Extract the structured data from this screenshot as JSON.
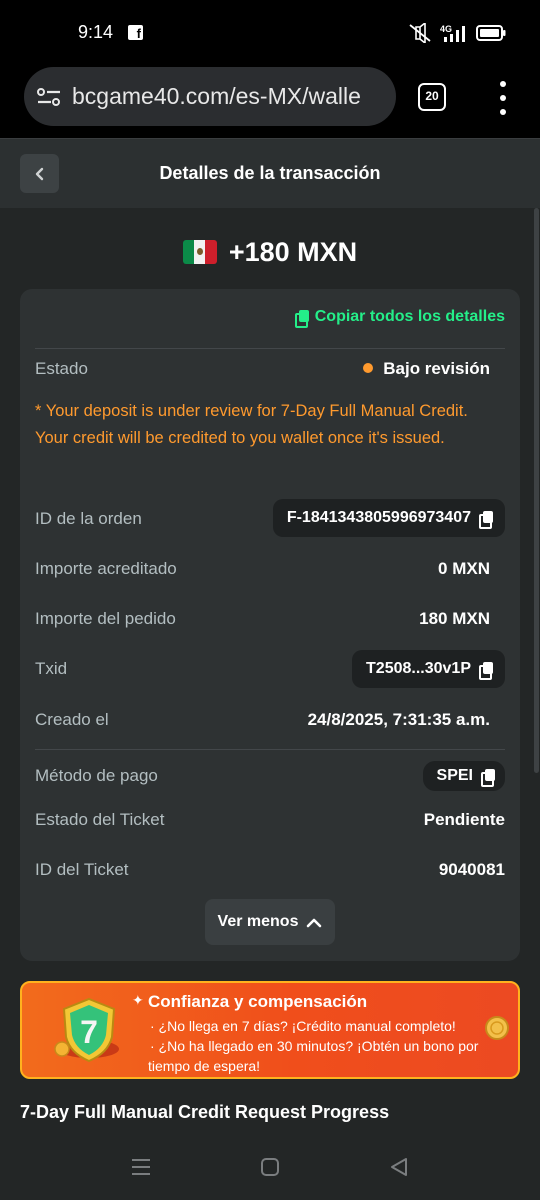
{
  "status_bar": {
    "time": "9:14",
    "network": "4G"
  },
  "browser": {
    "url": "bcgame40.com/es-MX/walle",
    "tab_count": "20"
  },
  "header": {
    "title": "Detalles de la transacción"
  },
  "amount": {
    "text": "+180 MXN",
    "flag": "mexico-flag"
  },
  "details": {
    "copy_all": "Copiar todos los detalles",
    "status_label": "Estado",
    "status_value": "Bajo revisión",
    "notice": "* Your deposit is under review for 7-Day Full Manual Credit. Your credit will be credited to you wallet once it's issued.",
    "order_id_label": "ID de la orden",
    "order_id_value": "F-1841343805996973407",
    "credited_label": "Importe acreditado",
    "credited_value": "0 MXN",
    "order_amount_label": "Importe del pedido",
    "order_amount_value": "180 MXN",
    "txid_label": "Txid",
    "txid_value": "T2508...30v1P",
    "created_label": "Creado el",
    "created_value": "24/8/2025, 7:31:35 a.m.",
    "payment_method_label": "Método de pago",
    "payment_method_value": "SPEI",
    "ticket_status_label": "Estado del Ticket",
    "ticket_status_value": "Pendiente",
    "ticket_id_label": "ID del Ticket",
    "ticket_id_value": "9040081",
    "ver_menos": "Ver menos"
  },
  "promo": {
    "title": "Confianza y compensación",
    "line1": "· ¿No llega en 7 días? ¡Crédito manual completo!",
    "line2": "· ¿No ha llegado en 30 minutos? ¡Obtén un bono por",
    "line3": "tiempo de espera!"
  },
  "progress": {
    "title": "7-Day Full Manual Credit Request Progress"
  },
  "colors": {
    "accent_green": "#24ee89",
    "warning_orange": "#ff9a2e",
    "card_bg": "#2e3233",
    "page_bg": "#232626"
  }
}
